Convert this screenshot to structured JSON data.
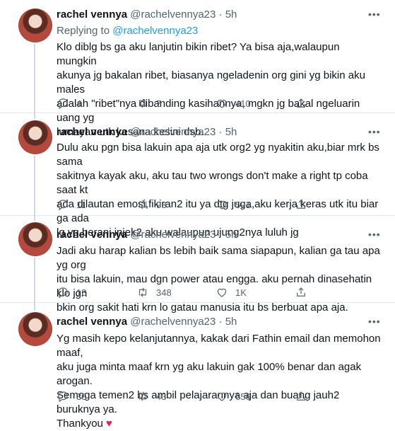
{
  "tweets": [
    {
      "name": "rachel vennya",
      "handle": "@rachelvennya23 · 5h",
      "replying_prefix": "Replying to ",
      "replying_to": "@rachelvennya23",
      "lines": [
        "Klo diblg bs ga aku lanjutin bikin ribet? Ya bisa aja,walaupun mungkin",
        "akunya jg bakalan ribet, biasanya ngeladenin org gini yg bikin aku males",
        "adalah \"ribet\"nya dibanding kasihannya, mgkn jg bakal ngeluarin uang yg",
        "lumayan utk kesana kesini dsb."
      ],
      "replies": "4",
      "retweets": "7",
      "likes": "410"
    },
    {
      "name": "rachel vennya",
      "handle": "@rachelvennya23 · 5h",
      "lines": [
        "Dulu aku pgn bisa lakuin apa aja utk org2 yg nyakitin aku,biar mrk bs sama",
        "sakitnya kayak aku, aku tau two wrongs don't make a right tp coba saat kt",
        "ada dilautan emosi,fikiran2 itu ya dtg juga,aku kerja keras utk itu biar ga ada",
        "lg yg berani injek2 aku walaupun ujung2nya luluh jg"
      ],
      "replies": "11",
      "retweets": "93",
      "likes": "591"
    },
    {
      "name": "rachel vennya",
      "handle": "@rachelvennya23 · 5h",
      "lines": [
        "Jadi aku harap kalian bs lebih baik sama siapapun, kalian ga tau apa yg org",
        "itu bisa lakuin, mau dgn power atau engga. aku pernah dinasehatin klo jgn",
        "bkin org sakit hati krn lo gatau manusia itu bs berbuat apa aja."
      ],
      "replies": "18",
      "retweets": "348",
      "likes": "1K"
    },
    {
      "name": "rachel vennya",
      "handle": "@rachelvennya23 · 5h",
      "lines": [
        "Yg masih kepo kelanjutannya, kakak dari Fathin email dan memohon maaf,",
        "aku juga minta maaf krn yg aku lakuin gak 100% benar dan agak arogan.",
        "Semoga temen2 bs ambil pelajarannya aja dan buang jauh2 buruknya ya.",
        "Thankyou"
      ],
      "heart": "♥",
      "replies": "30",
      "retweets": "43",
      "likes": "656"
    }
  ],
  "icons": {
    "more": "more-horizontal-icon",
    "reply": "reply-bubble-icon",
    "retweet": "retweet-icon",
    "like": "heart-outline-icon",
    "share": "share-icon"
  },
  "colors": {
    "name": "#0f1419",
    "secondary": "#536471",
    "link": "#1d9bf0",
    "heart": "#e0245e",
    "divider": "#e1e8ed"
  }
}
